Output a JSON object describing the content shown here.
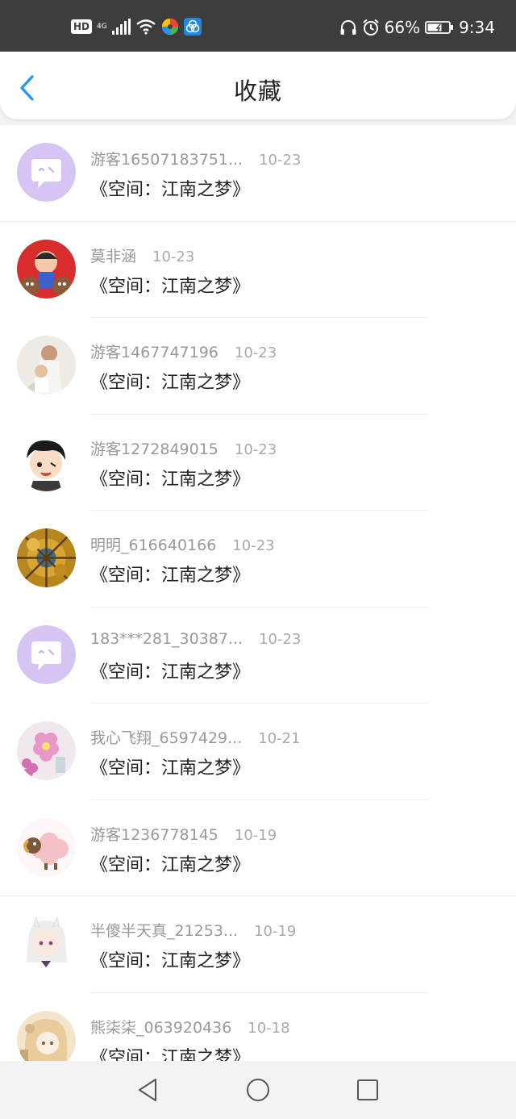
{
  "status_bar": {
    "hd_label": "HD",
    "network": "4G",
    "battery": "66%",
    "time": "9:34"
  },
  "header": {
    "title": "收藏"
  },
  "items": [
    {
      "name": "游客16507183751...",
      "date": "10-23",
      "content": "《空间：江南之梦》",
      "avatar": "chat-bubble-default"
    },
    {
      "name": "莫非涵",
      "date": "10-23",
      "content": "《空间：江南之梦》",
      "avatar": "cartoon-red"
    },
    {
      "name": "游客1467747196",
      "date": "10-23",
      "content": "《空间：江南之梦》",
      "avatar": "photo-family"
    },
    {
      "name": "游客1272849015",
      "date": "10-23",
      "content": "《空间：江南之梦》",
      "avatar": "anime-boy"
    },
    {
      "name": "明明_616640166",
      "date": "10-23",
      "content": "《空间：江南之梦》",
      "avatar": "autumn-trees"
    },
    {
      "name": "183***281_30387...",
      "date": "10-23",
      "content": "《空间：江南之梦》",
      "avatar": "chat-bubble-default"
    },
    {
      "name": "我心飞翔_6597429...",
      "date": "10-21",
      "content": "《空间：江南之梦》",
      "avatar": "pink-flowers"
    },
    {
      "name": "游客1236778145",
      "date": "10-19",
      "content": "《空间：江南之梦》",
      "avatar": "cartoon-sheep"
    },
    {
      "name": "半傻半天真_21253...",
      "date": "10-19",
      "content": "《空间：江南之梦》",
      "avatar": "anime-girl-white"
    },
    {
      "name": "熊柒柒_063920436",
      "date": "10-18",
      "content": "《空间：江南之梦》",
      "avatar": "anime-girl-beige"
    }
  ],
  "colors": {
    "accent": "#2196f3",
    "status_bar": "#3d3d3d",
    "default_avatar": "#d6c4f2"
  }
}
